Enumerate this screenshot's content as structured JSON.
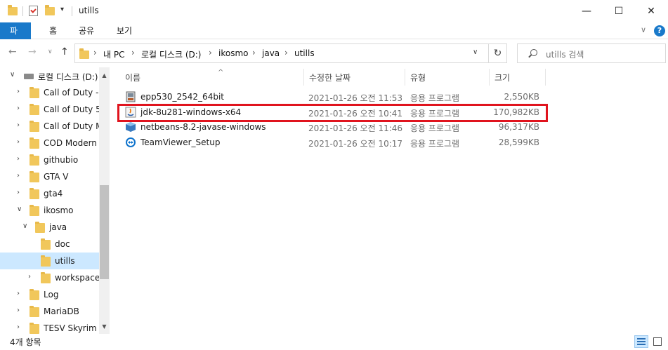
{
  "window": {
    "title": "utills",
    "controls": {
      "minimize": "—",
      "maximize": "☐",
      "close": "✕"
    }
  },
  "ribbon": {
    "tabs": [
      "파일",
      "홈",
      "공유",
      "보기"
    ],
    "help": "?"
  },
  "address": {
    "crumbs": [
      "내 PC",
      "로컬 디스크 (D:)",
      "ikosmo",
      "java",
      "utills"
    ],
    "separator": "›",
    "search_placeholder": "utills 검색"
  },
  "tree": {
    "items": [
      {
        "label": "로컬 디스크 (D:)",
        "level": 0,
        "expand": "∨",
        "type": "drive"
      },
      {
        "label": "Call of Duty -",
        "level": 1,
        "expand": "›",
        "type": "folder"
      },
      {
        "label": "Call of Duty 5",
        "level": 1,
        "expand": "›",
        "type": "folder"
      },
      {
        "label": "Call of Duty M",
        "level": 1,
        "expand": "›",
        "type": "folder"
      },
      {
        "label": "COD Modern V",
        "level": 1,
        "expand": "›",
        "type": "folder"
      },
      {
        "label": "githubio",
        "level": 1,
        "expand": "›",
        "type": "folder"
      },
      {
        "label": "GTA V",
        "level": 1,
        "expand": "›",
        "type": "folder"
      },
      {
        "label": "gta4",
        "level": 1,
        "expand": "›",
        "type": "folder"
      },
      {
        "label": "ikosmo",
        "level": 1,
        "expand": "∨",
        "type": "folder"
      },
      {
        "label": "java",
        "level": 2,
        "expand": "∨",
        "type": "folder"
      },
      {
        "label": "doc",
        "level": 3,
        "expand": "",
        "type": "folder"
      },
      {
        "label": "utills",
        "level": 3,
        "expand": "",
        "type": "folder",
        "selected": true
      },
      {
        "label": "workspace",
        "level": 3,
        "expand": "›",
        "type": "folder"
      },
      {
        "label": "Log",
        "level": 1,
        "expand": "›",
        "type": "folder"
      },
      {
        "label": "MariaDB",
        "level": 1,
        "expand": "›",
        "type": "folder"
      },
      {
        "label": "TESV Skyrim S",
        "level": 1,
        "expand": "›",
        "type": "folder"
      }
    ]
  },
  "filelist": {
    "columns": [
      "이름",
      "수정한 날짜",
      "유형",
      "크기"
    ],
    "rows": [
      {
        "name": "epp530_2542_64bit",
        "date": "2021-01-26 오전 11:53",
        "type": "응용 프로그램",
        "size": "2,550KB",
        "icon": "installer-icon"
      },
      {
        "name": "jdk-8u281-windows-x64",
        "date": "2021-01-26 오전 10:41",
        "type": "응용 프로그램",
        "size": "170,982KB",
        "icon": "java-icon"
      },
      {
        "name": "netbeans-8.2-javase-windows",
        "date": "2021-01-26 오전 11:46",
        "type": "응용 프로그램",
        "size": "96,317KB",
        "icon": "netbeans-icon"
      },
      {
        "name": "TeamViewer_Setup",
        "date": "2021-01-26 오전 10:17",
        "type": "응용 프로그램",
        "size": "28,599KB",
        "icon": "teamviewer-icon"
      }
    ]
  },
  "status": {
    "item_count": "4개 항목"
  },
  "colors": {
    "accent": "#1979ca",
    "selection": "#cce8ff",
    "highlight_box": "#e0141e",
    "folder": "#f1c75b"
  }
}
